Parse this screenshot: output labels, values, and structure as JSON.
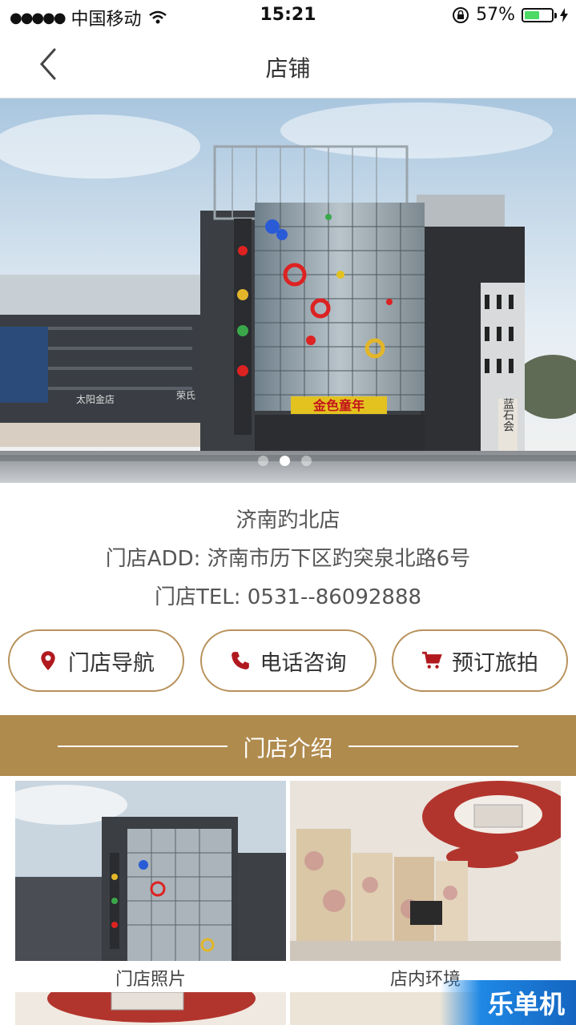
{
  "status_bar": {
    "signal_dots": "●●●●●",
    "carrier": "中国移动",
    "time": "15:21",
    "battery_percent": "57%",
    "battery_level": 0.57,
    "icons": [
      "wifi-icon",
      "rotation-lock-icon",
      "battery-icon",
      "charging-icon"
    ]
  },
  "navbar": {
    "title": "店铺",
    "back_icon": "chevron-left-icon"
  },
  "banner": {
    "slide_count": 3,
    "active_slide": 1,
    "sign_text": "金色童年",
    "left_sign_1": "太阳金店",
    "left_sign_2": "荣氏",
    "right_sign": "蓝石会"
  },
  "store": {
    "name": "济南趵北店",
    "address": "门店ADD: 济南市历下区趵突泉北路6号",
    "phone": "门店TEL: 0531--86092888"
  },
  "actions": [
    {
      "label": "门店导航",
      "icon": "map-pin-icon"
    },
    {
      "label": "电话咨询",
      "icon": "phone-icon"
    },
    {
      "label": "预订旅拍",
      "icon": "cart-icon"
    }
  ],
  "section": {
    "title": "门店介绍"
  },
  "gallery": [
    {
      "caption": "门店照片"
    },
    {
      "caption": "店内环境"
    }
  ],
  "watermark": "乐单机",
  "colors": {
    "accent": "#b08b4e",
    "icon_red": "#b0191e",
    "button_border": "#b8925b"
  }
}
